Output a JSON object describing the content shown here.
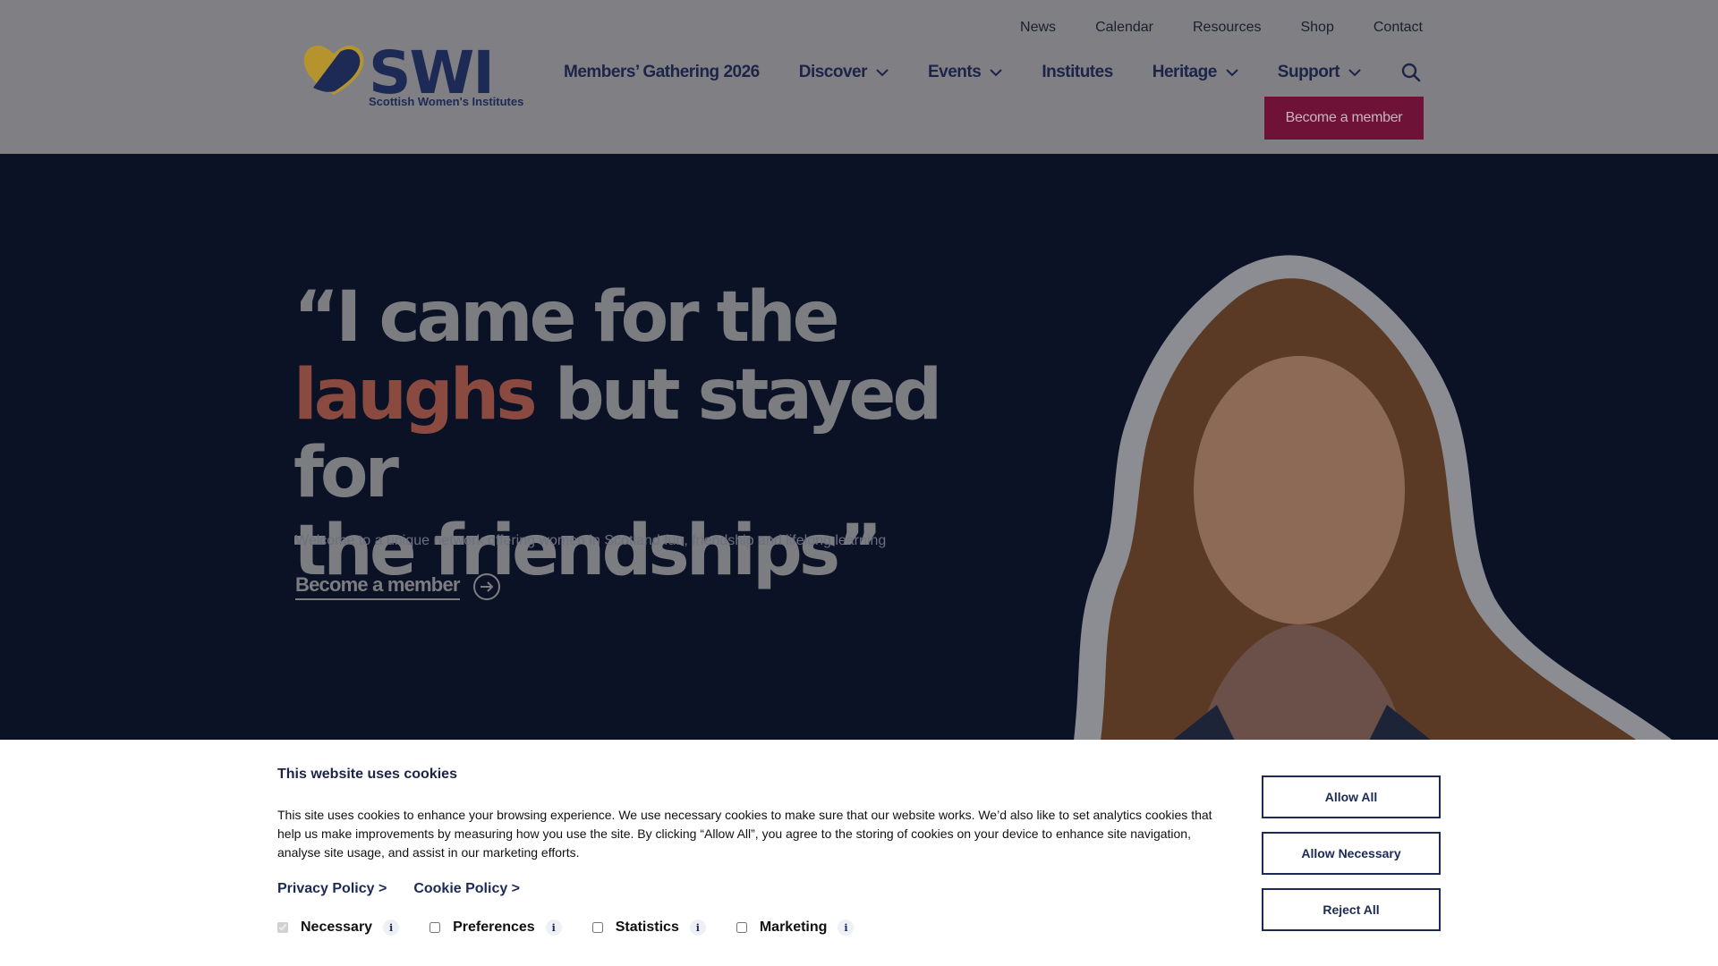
{
  "header": {
    "logo_text": "SWI",
    "logo_sub": "Scottish Women's Institutes",
    "top_links": [
      "News",
      "Calendar",
      "Resources",
      "Shop",
      "Contact"
    ],
    "nav": [
      {
        "label": "Members’ Gathering 2026",
        "dropdown": false
      },
      {
        "label": "Discover",
        "dropdown": true
      },
      {
        "label": "Events",
        "dropdown": true
      },
      {
        "label": "Institutes",
        "dropdown": false
      },
      {
        "label": "Heritage",
        "dropdown": true
      },
      {
        "label": "Support",
        "dropdown": true
      }
    ],
    "become_member": "Become a member",
    "search_icon": "search-icon"
  },
  "hero": {
    "quote_line1": "“I came for the",
    "quote_highlight": "laughs",
    "quote_line2_rest": " but stayed for",
    "quote_line3": "the friendships”",
    "subtitle": "Welcome to a unique network offering women in Scotland fun, friendship and lifelong learning",
    "cta": "Become a member"
  },
  "cookie": {
    "title": "This website uses cookies",
    "text": "This site uses cookies to enhance your browsing experience. We use necessary cookies to make sure that our website works. We’d also like to set analytics cookies that help us make improvements by measuring how you use the site. By clicking “Allow All”, you agree to the storing of cookies on your device to enhance site navigation, analyse site usage, and assist in our marketing efforts.",
    "privacy_link": "Privacy Policy >",
    "cookie_link": "Cookie Policy >",
    "checks": [
      {
        "label": "Necessary",
        "checked": true,
        "disabled": true
      },
      {
        "label": "Preferences",
        "checked": false,
        "disabled": false
      },
      {
        "label": "Statistics",
        "checked": false,
        "disabled": false
      },
      {
        "label": "Marketing",
        "checked": false,
        "disabled": false
      }
    ],
    "info_glyph": "i",
    "buttons": {
      "allow_all": "Allow All",
      "allow_necessary": "Allow Necessary",
      "reject_all": "Reject All"
    }
  },
  "colors": {
    "brand_navy": "#1c2a55",
    "brand_maroon": "#6e1238",
    "hero_bg": "#0b1226",
    "highlight": "#8a4a40"
  }
}
